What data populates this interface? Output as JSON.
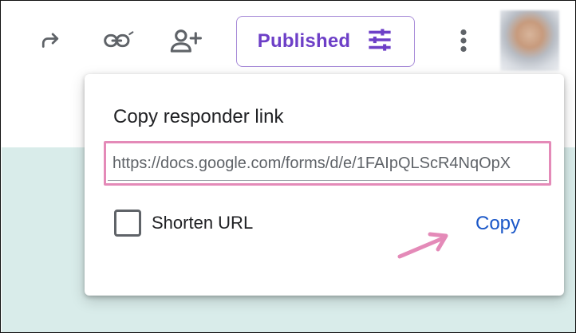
{
  "toolbar": {
    "icons": [
      {
        "name": "redo-icon"
      },
      {
        "name": "link-icon"
      },
      {
        "name": "add-collaborator-icon"
      },
      {
        "name": "more-vert-icon"
      }
    ],
    "published_label": "Published",
    "published_icon": "tune-sliders-icon"
  },
  "popup": {
    "title": "Copy responder link",
    "link_value": "https://docs.google.com/forms/d/e/1FAIpQLScR4NqOpX",
    "shorten_label": "Shorten URL",
    "shorten_checked": false,
    "copy_label": "Copy"
  },
  "colors": {
    "accent_purple": "#6d3fc7",
    "highlight_pink": "#e48ab8",
    "link_blue": "#1a57c8",
    "background_band": "#d9ecea"
  }
}
